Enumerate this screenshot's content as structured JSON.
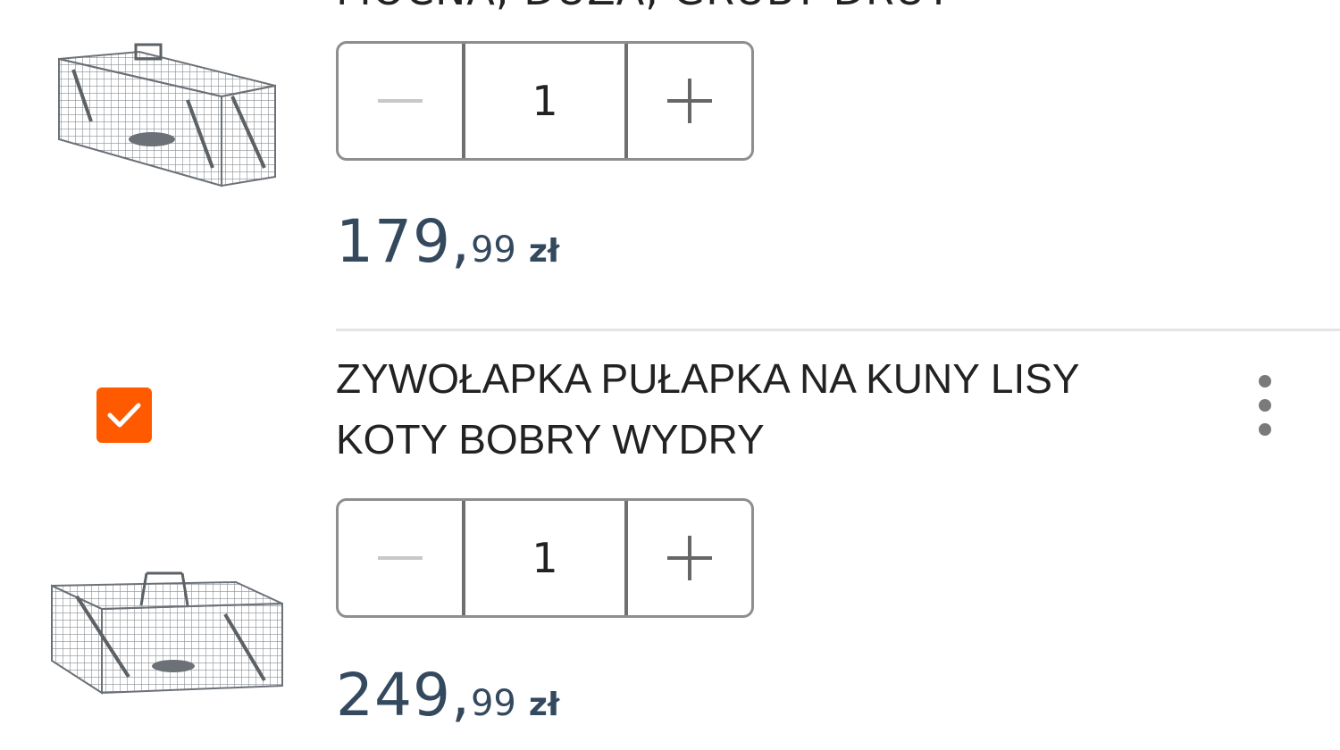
{
  "items": [
    {
      "title_cut": "MOCNA, DUŻA, GRUBY DRUT",
      "quantity": "1",
      "price_int": "179,",
      "price_dec": "99",
      "currency": "zł",
      "image_icon": "cage-trap-image"
    },
    {
      "title": "ZYWOŁAPKA PUŁAPKA NA KUNY LISY KOTY BOBRY WYDRY",
      "checked": true,
      "quantity": "1",
      "price_int": "249,",
      "price_dec": "99",
      "currency": "zł",
      "image_icon": "cage-trap-image",
      "menu_icon": "more-vertical-icon"
    }
  ],
  "icons": {
    "minus": "minus-icon",
    "plus": "plus-icon",
    "check": "check-icon"
  },
  "colors": {
    "accent": "#ff5a00",
    "price": "#34495e",
    "border": "#8e8e8e",
    "divider": "#e4e4e4"
  }
}
